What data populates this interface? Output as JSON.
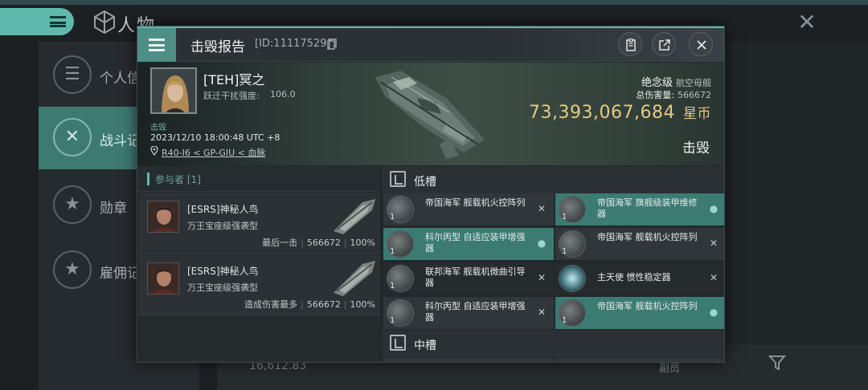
{
  "background": {
    "page_title": "人物",
    "sidebar": [
      {
        "label": "个人信",
        "icon": "list-icon",
        "active": false
      },
      {
        "label": "战斗记",
        "icon": "crossed-swords-icon",
        "active": true
      },
      {
        "label": "勋章",
        "icon": "star-medal-icon",
        "active": false
      },
      {
        "label": "雇佣记",
        "icon": "star-badge-icon",
        "active": false
      }
    ],
    "bottom_value": "16,612.83",
    "bottom_tag": "副员"
  },
  "modal": {
    "title": "击毁报告",
    "report_id": "[ID:11117529]",
    "victim": {
      "name": "[TEH]冥之",
      "jam_label": "跃迁干扰强度:",
      "jam_value": "106.0",
      "kill_tag": "击毁",
      "time": "2023/12/10 18:00:48 UTC +8",
      "location": "R40-I6 < GP-GIU < 血脉"
    },
    "ship": {
      "name": "绝念级",
      "type": "航空母舰",
      "damage_label": "总伤害量:",
      "damage_value": "566672",
      "isk_value": "73,393,067,684",
      "isk_unit": "星币",
      "status": "击毁"
    },
    "participants_header": "参与者 [1]",
    "participants": [
      {
        "name": "[ESRS]神秘人鸟",
        "ship": "万王宝座级强袭型",
        "role": "最后一击",
        "damage": "566672",
        "percent": "100%"
      },
      {
        "name": "[ESRS]神秘人鸟",
        "ship": "万王宝座级强袭型",
        "role": "造成伤害最多",
        "damage": "566672",
        "percent": "100%"
      }
    ],
    "low_slot_label": "低槽",
    "mid_slot_label": "中槽",
    "low_slot_modules": [
      {
        "name": "帝国海军 舰载机火控阵列",
        "qty": "1",
        "status": "destroyed",
        "highlight": false
      },
      {
        "name": "帝国海军 旗舰级装甲维修器",
        "qty": "1",
        "status": "dropped",
        "highlight": true
      },
      {
        "name": "科尔丙型 自适应装甲增强器",
        "qty": "1",
        "status": "dropped",
        "highlight": true
      },
      {
        "name": "帝国海军 舰载机火控阵列",
        "qty": "1",
        "status": "destroyed",
        "highlight": false
      },
      {
        "name": "联邦海军 舰载机微曲引导器",
        "qty": "1",
        "status": "destroyed",
        "highlight": false
      },
      {
        "name": "主天使 惯性稳定器",
        "qty": "",
        "status": "destroyed",
        "highlight": false
      },
      {
        "name": "科尔丙型 自适应装甲增强器",
        "qty": "1",
        "status": "destroyed",
        "highlight": false
      },
      {
        "name": "帝国海军 舰载机火控阵列",
        "qty": "1",
        "status": "dropped",
        "highlight": true
      }
    ]
  }
}
